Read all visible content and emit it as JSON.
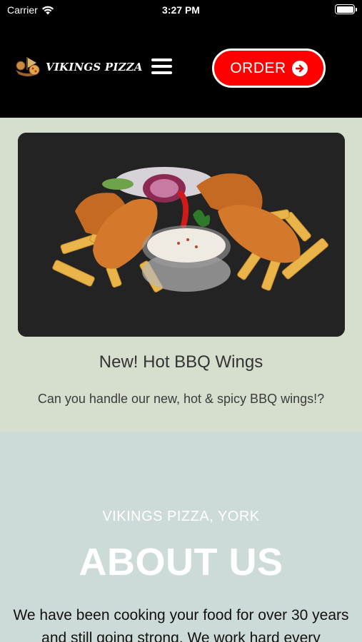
{
  "status_bar": {
    "carrier": "Carrier",
    "time": "3:27 PM"
  },
  "header": {
    "logo_text": "VIKINGS PIZZA",
    "order_label": "ORDER",
    "accent_color": "#ff0000"
  },
  "promo": {
    "title": "New! Hot BBQ Wings",
    "description": "Can you handle our new, hot & spicy BBQ wings!?",
    "background_color": "#d6dfcd"
  },
  "about": {
    "subtitle": "VIKINGS PIZZA, YORK",
    "title": "ABOUT US",
    "body": "We have been cooking your food for over 30 years and still going strong. We work hard every",
    "background_color": "#cddbd8"
  },
  "icons": {
    "wifi": "wifi-icon",
    "battery": "battery-icon",
    "menu": "hamburger-menu-icon",
    "order": "arrow-circle-right-icon"
  }
}
